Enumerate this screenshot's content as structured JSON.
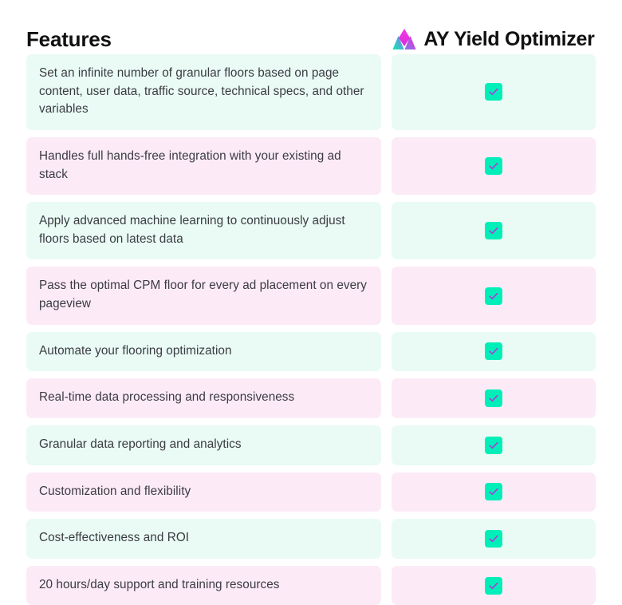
{
  "header": {
    "features_label": "Features",
    "product_name": "AY Yield Optimizer",
    "logo_icon": "ay-mountain-logo-icon"
  },
  "colors": {
    "mint_row": "#e9fbf4",
    "pink_row": "#fcebf7",
    "check_bg": "#00efb8",
    "check_mark": "#a93fd9",
    "text": "#3b3b42",
    "heading": "#111111",
    "logo_teal": "#2fe0b0",
    "logo_magenta": "#e838d8",
    "logo_purple": "#8b5cf6"
  },
  "rows": [
    {
      "feature": "Set an infinite number of granular floors based on page content, user data, traffic source, technical specs, and other variables",
      "tint": "mint",
      "supported": true,
      "check_icon": "check-icon"
    },
    {
      "feature": "Handles full hands-free integration with your existing ad stack",
      "tint": "pink",
      "supported": true,
      "check_icon": "check-icon"
    },
    {
      "feature": "Apply advanced machine learning to continuously adjust floors based on latest data",
      "tint": "mint",
      "supported": true,
      "check_icon": "check-icon"
    },
    {
      "feature": "Pass the optimal CPM floor for every ad placement on every pageview",
      "tint": "pink",
      "supported": true,
      "check_icon": "check-icon"
    },
    {
      "feature": "Automate your flooring optimization",
      "tint": "mint",
      "supported": true,
      "check_icon": "check-icon"
    },
    {
      "feature": "Real-time data processing and responsiveness",
      "tint": "pink",
      "supported": true,
      "check_icon": "check-icon"
    },
    {
      "feature": "Granular data reporting and analytics",
      "tint": "mint",
      "supported": true,
      "check_icon": "check-icon"
    },
    {
      "feature": "Customization and flexibility",
      "tint": "pink",
      "supported": true,
      "check_icon": "check-icon"
    },
    {
      "feature": "Cost-effectiveness and ROI",
      "tint": "mint",
      "supported": true,
      "check_icon": "check-icon"
    },
    {
      "feature": "20 hours/day support and training resources",
      "tint": "pink",
      "supported": true,
      "check_icon": "check-icon"
    }
  ]
}
